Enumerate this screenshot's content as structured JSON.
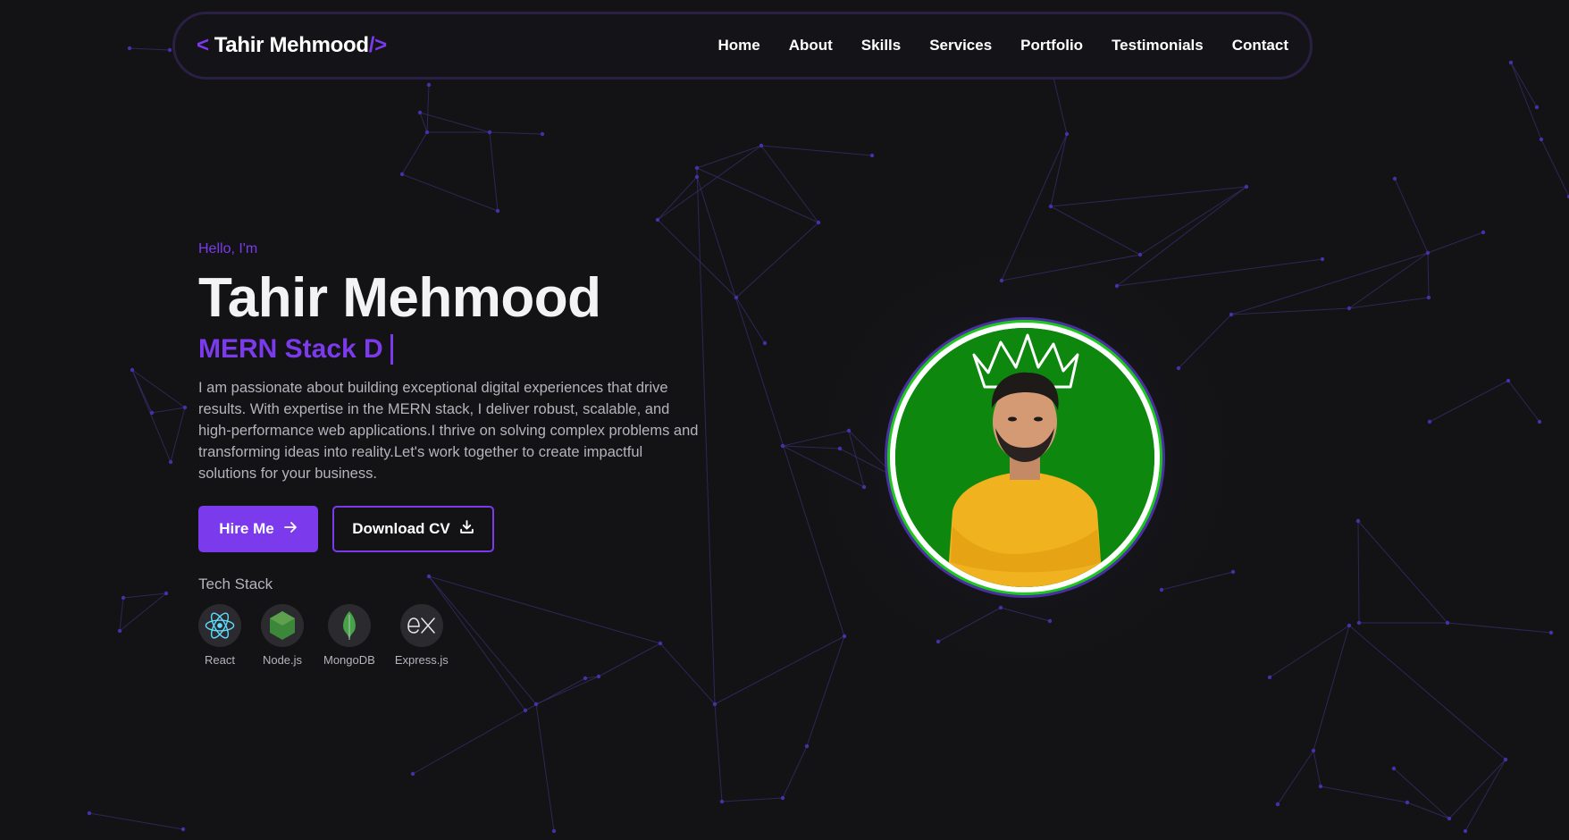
{
  "nav": {
    "logo_open": "<",
    "logo_name": "Tahir Mehmood",
    "logo_close": "/>",
    "links": [
      "Home",
      "About",
      "Skills",
      "Services",
      "Portfolio",
      "Testimonials",
      "Contact"
    ]
  },
  "hero": {
    "greeting": "Hello, I'm",
    "name": "Tahir Mehmood",
    "role_typed": "MERN Stack D",
    "description": "I am passionate about building exceptional digital experiences that drive results. With expertise in the MERN stack, I deliver robust, scalable, and high-performance web applications.I thrive on solving complex problems and transforming ideas into reality.Let's work together to create impactful solutions for your business.",
    "hire_label": "Hire Me",
    "hire_icon": "arrow-right-icon",
    "cv_label": "Download CV",
    "cv_icon": "download-icon",
    "tech_title": "Tech Stack",
    "tech": [
      {
        "label": "React",
        "icon": "react-icon"
      },
      {
        "label": "Node.js",
        "icon": "nodejs-icon"
      },
      {
        "label": "MongoDB",
        "icon": "mongodb-icon"
      },
      {
        "label": "Express.js",
        "icon": "express-icon"
      }
    ]
  },
  "profile": {
    "image": "profile-photo"
  },
  "colors": {
    "accent": "#7c3aed",
    "background": "#131315",
    "text_muted": "#b4b4bc",
    "avatar_ring": "#1ec71e",
    "avatar_bg": "#0d870d"
  }
}
